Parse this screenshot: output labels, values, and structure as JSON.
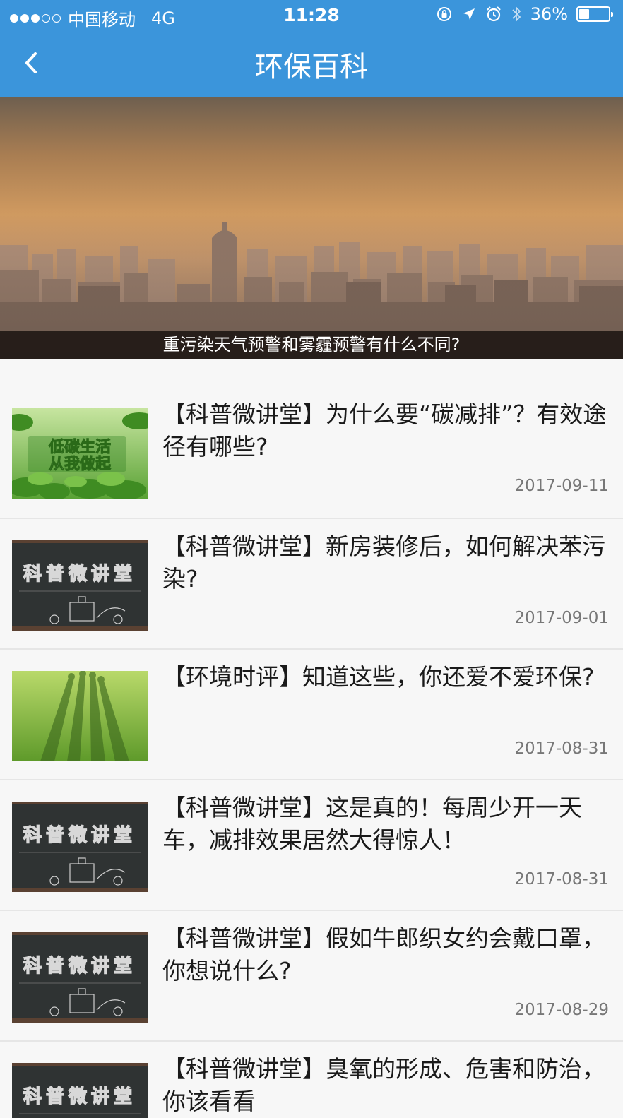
{
  "status_bar": {
    "carrier": "中国移动",
    "network": "4G",
    "time": "11:28",
    "battery_percent": "36%",
    "battery_level": 0.36,
    "signal_strength": 3,
    "icons": [
      "orientation-lock-icon",
      "location-icon",
      "alarm-icon",
      "bluetooth-icon"
    ]
  },
  "nav": {
    "title": "环保百科",
    "back_icon": "chevron-left-icon"
  },
  "banner": {
    "caption": "重污染天气预警和雾霾预警有什么不同?"
  },
  "articles": [
    {
      "title": "【科普微讲堂】为什么要“碳减排”？有效途径有哪些?",
      "date": "2017-09-11",
      "thumb": "low-carbon-poster",
      "thumb_text_line1": "低碳生活",
      "thumb_text_line2": "从我做起"
    },
    {
      "title": "【科普微讲堂】新房装修后，如何解决苯污染?",
      "date": "2017-09-01",
      "thumb": "chalkboard",
      "thumb_text": "科普微讲堂"
    },
    {
      "title": "【环境时评】知道这些，你还爱不爱环保?",
      "date": "2017-08-31",
      "thumb": "grass-shadows"
    },
    {
      "title": "【科普微讲堂】这是真的！每周少开一天车，减排效果居然大得惊人！",
      "date": "2017-08-31",
      "thumb": "chalkboard",
      "thumb_text": "科普微讲堂"
    },
    {
      "title": "【科普微讲堂】假如牛郎织女约会戴口罩，你想说什么?",
      "date": "2017-08-29",
      "thumb": "chalkboard",
      "thumb_text": "科普微讲堂"
    },
    {
      "title": "【科普微讲堂】臭氧的形成、危害和防治，你该看看",
      "date": "",
      "thumb": "chalkboard",
      "thumb_text": "科普微讲堂"
    }
  ],
  "colors": {
    "header_bg": "#3b95db",
    "page_bg": "#f7f7f7",
    "title_text": "#1a1a1a",
    "date_text": "#777777"
  }
}
